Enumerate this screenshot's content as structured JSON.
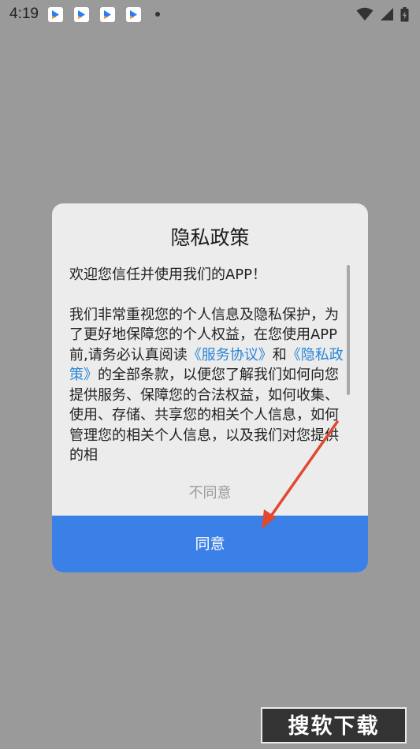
{
  "status_bar": {
    "time": "4:19",
    "notification_icons": [
      "app-notification-icon",
      "app-notification-icon",
      "app-notification-icon",
      "app-notification-icon"
    ],
    "icons": [
      "wifi-icon",
      "signal-icon",
      "battery-charging-icon"
    ]
  },
  "dialog": {
    "title": "隐私政策",
    "intro": "欢迎您信任并使用我们的APP！",
    "body_part1": " 我们非常重视您的个人信息及隐私保护，为了更好地保障您的个人权益，在您使用APP前,请务必认真阅读",
    "service_link": "《服务协议》",
    "body_and": "和",
    "privacy_link": "《隐私政策》",
    "body_part2": "的全部条款，以便您了解我们如何向您提供服务、保障您的合法权益，如何收集、使用、存储、共享您的相关个人信息，如何管理您的相关个人信息，以及我们对您提供的相",
    "disagree_label": "不同意",
    "agree_label": "同意"
  },
  "colors": {
    "overlay": "#9a9a9a",
    "dialog_bg": "#ececec",
    "agree_bg": "#3b80e6",
    "link": "#2a86d6",
    "annotation_arrow": "#e0492f"
  },
  "watermark": {
    "text": "搜软下载"
  }
}
